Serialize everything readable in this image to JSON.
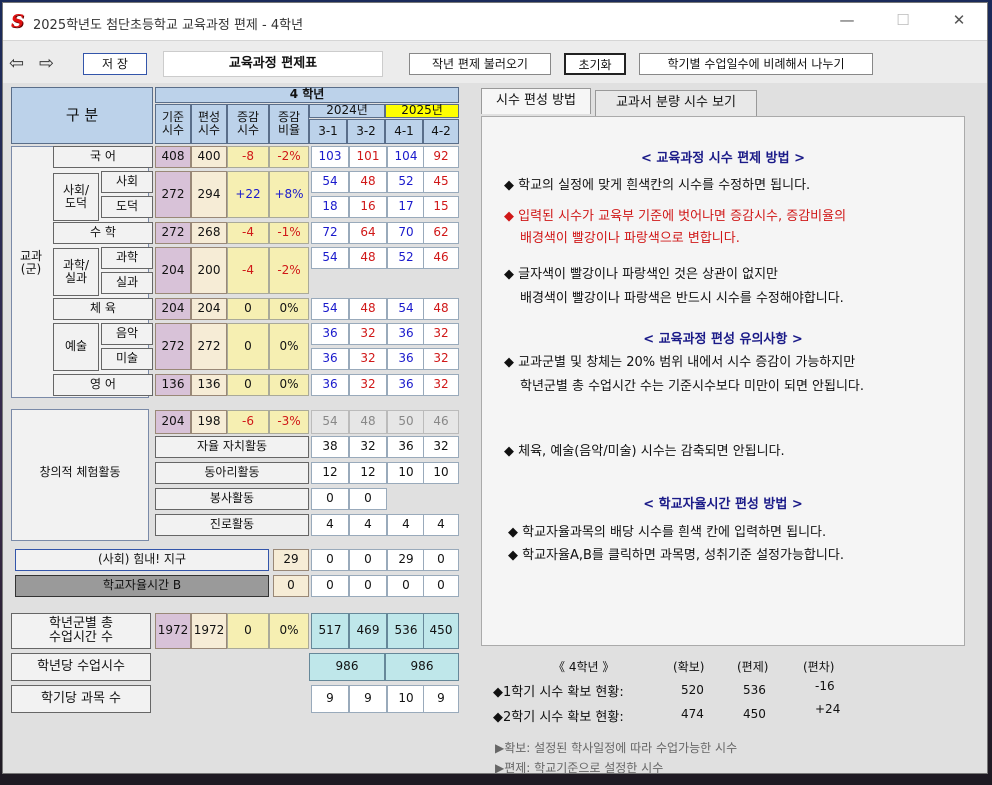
{
  "window": {
    "title": "2025학년도 첨단초등학교 교육과정 편제 - 4학년",
    "min": "—",
    "max": "☐",
    "close": "✕"
  },
  "toolbar": {
    "save": "저 장",
    "title": "교육과정 편제표",
    "load_prev": "작년 편제 불러오기",
    "reset": "초기화",
    "divide": "학기별 수업일수에 비례해서 나누기"
  },
  "header": {
    "gubun": "구    분",
    "grade": "4 학년",
    "std": "기준\n시수",
    "plan": "편성\n시수",
    "diff": "증감\n시수",
    "ratio": "증감\n비율",
    "y2024": "2024년",
    "y2025": "2025년",
    "s31": "3-1",
    "s32": "3-2",
    "s41": "4-1",
    "s42": "4-2"
  },
  "groups": {
    "subject": "교과\n(군)",
    "social": "사회/\n도덕",
    "science": "과학/\n실과",
    "arts": "예술",
    "creative": "창의적 체험활동"
  },
  "rows": {
    "korean": {
      "label": "국 어",
      "std": "408",
      "plan": "400",
      "diff": "-8",
      "ratio": "-2%",
      "v": [
        "103",
        "101",
        "104",
        "92"
      ]
    },
    "social": {
      "label": "사회",
      "std": "272",
      "plan": "294",
      "diff": "+22",
      "ratio": "+8%",
      "v": [
        "54",
        "48",
        "52",
        "45"
      ]
    },
    "moral": {
      "label": "도덕",
      "v": [
        "18",
        "16",
        "17",
        "15"
      ]
    },
    "math": {
      "label": "수 학",
      "std": "272",
      "plan": "268",
      "diff": "-4",
      "ratio": "-1%",
      "v": [
        "72",
        "64",
        "70",
        "62"
      ]
    },
    "science": {
      "label": "과학",
      "std": "204",
      "plan": "200",
      "diff": "-4",
      "ratio": "-2%",
      "v": [
        "54",
        "48",
        "52",
        "46"
      ]
    },
    "practical": {
      "label": "실과"
    },
    "pe": {
      "label": "체 육",
      "std": "204",
      "plan": "204",
      "diff": "0",
      "ratio": "0%",
      "v": [
        "54",
        "48",
        "54",
        "48"
      ]
    },
    "music": {
      "label": "음악",
      "std": "272",
      "plan": "272",
      "diff": "0",
      "ratio": "0%",
      "v": [
        "36",
        "32",
        "36",
        "32"
      ]
    },
    "art": {
      "label": "미술",
      "v": [
        "36",
        "32",
        "36",
        "32"
      ]
    },
    "english": {
      "label": "영 어",
      "std": "136",
      "plan": "136",
      "diff": "0",
      "ratio": "0%",
      "v": [
        "36",
        "32",
        "36",
        "32"
      ]
    },
    "creative": {
      "std": "204",
      "plan": "198",
      "diff": "-6",
      "ratio": "-3%",
      "v": [
        "54",
        "48",
        "50",
        "46"
      ]
    },
    "autonomy": {
      "label": "자율 자치활동",
      "v": [
        "38",
        "32",
        "36",
        "32"
      ]
    },
    "club": {
      "label": "동아리활동",
      "v": [
        "12",
        "12",
        "10",
        "10"
      ]
    },
    "service": {
      "label": "봉사활동",
      "v": [
        "0",
        "0"
      ]
    },
    "career": {
      "label": "진로활동",
      "v": [
        "4",
        "4",
        "4",
        "4"
      ]
    },
    "earth": {
      "label": "(사회) 힘내! 지구",
      "plan": "29",
      "v": [
        "0",
        "0",
        "29",
        "0"
      ]
    },
    "schoolB": {
      "label": "학교자율시간 B",
      "plan": "0",
      "v": [
        "0",
        "0",
        "0",
        "0"
      ]
    },
    "total": {
      "label": "학년군별 총\n수업시간 수",
      "std": "1972",
      "plan": "1972",
      "diff": "0",
      "ratio": "0%",
      "v": [
        "517",
        "469",
        "536",
        "450"
      ]
    },
    "perYear": {
      "label": "학년당 수업시수",
      "v2024": "986",
      "v2025": "986"
    },
    "perSem": {
      "label": "학기당 과목 수",
      "v": [
        "9",
        "9",
        "10",
        "9"
      ]
    }
  },
  "tabs": {
    "method": "시수 편성 방법",
    "textbook": "교과서 분량 시수 보기"
  },
  "panel": {
    "h1": "< 교육과정 시수 편제 방법 >",
    "l1": "◆ 학교의 실정에 맞게 흰색칸의 시수를 수정하면 됩니다.",
    "l2": "◆ 입력된 시수가 교육부 기준에 벗어나면 증감시수, 증감비율의",
    "l3": "배경색이 빨강이나 파랑색으로 변합니다.",
    "l4": "◆ 글자색이 빨강이나 파랑색인 것은 상관이 없지만",
    "l5": "배경색이 빨강이나 파랑색은 반드시 시수를 수정해야합니다.",
    "h2": "< 교육과정 편성 유의사항 >",
    "l6": "◆ 교과군별 및 창체는 20% 범위 내에서 시수 증감이 가능하지만",
    "l7": "학년군별 총 수업시간 수는 기준시수보다 미만이 되면 안됩니다.",
    "l8": "◆ 체육, 예술(음악/미술) 시수는 감축되면 안됩니다.",
    "h3": "< 학교자율시간 편성 방법 >",
    "l9": "◆ 학교자율과목의 배당 시수를 흰색 칸에 입력하면 됩니다.",
    "l10": "◆ 학교자율A,B를 클릭하면 과목명, 성취기준 설정가능합니다."
  },
  "summary": {
    "grade": "《 4학년 》",
    "c1": "(확보)",
    "c2": "(편제)",
    "c3": "(편차)",
    "s1": "◆1학기 시수 확보 현황:",
    "s1a": "520",
    "s1b": "536",
    "s1c": "-16",
    "s2": "◆2학기 시수 확보 현황:",
    "s2a": "474",
    "s2b": "450",
    "s2c": "+24"
  },
  "footer": {
    "f1": "▶확보: 설정된 학사일정에 따라 수업가능한 시수",
    "f2": "▶편제: 학교기준으로 설정한 시수"
  },
  "colors": {
    "accent_red": "#d01818",
    "accent_blue": "#1a1acc",
    "yellow": "#ffff00",
    "cyan": "#bfe7ea"
  }
}
